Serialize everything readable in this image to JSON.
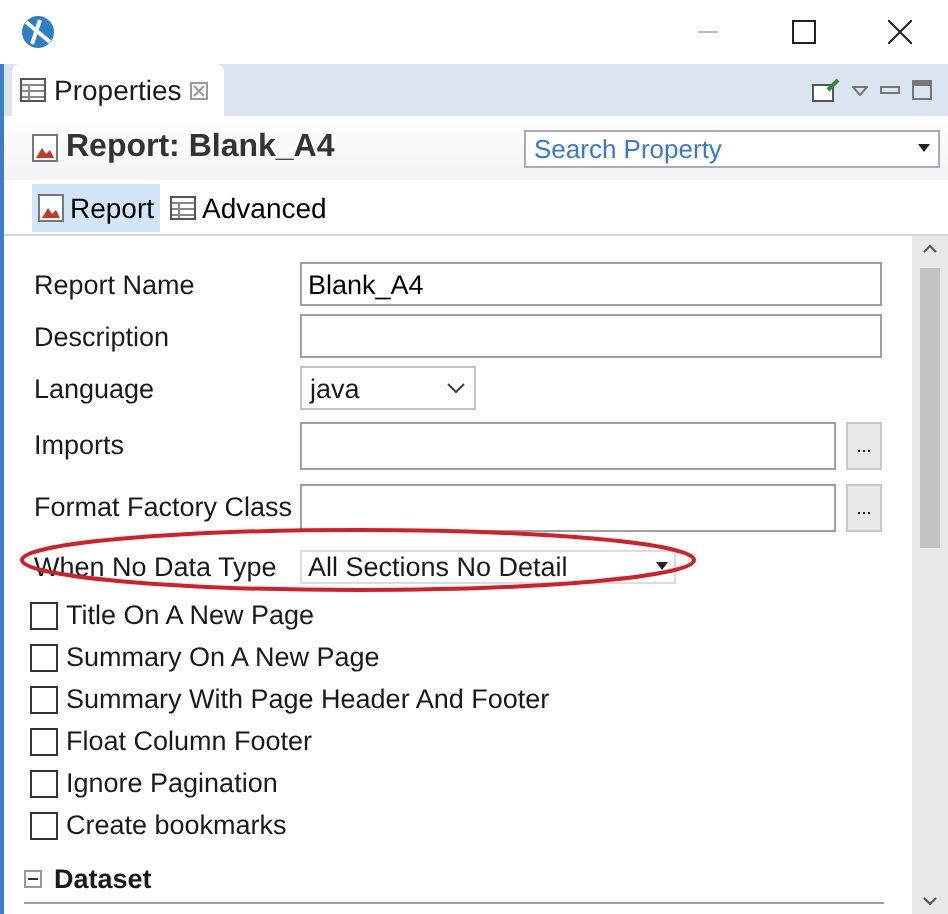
{
  "tab": {
    "label": "Properties"
  },
  "header": {
    "title": "Report: Blank_A4",
    "search": {
      "placeholder": "Search Property"
    }
  },
  "subtabs": [
    {
      "label": "Report",
      "selected": true
    },
    {
      "label": "Advanced",
      "selected": false
    }
  ],
  "fields": [
    {
      "label": "Report Name",
      "kind": "text",
      "value": "Blank_A4",
      "highlighted": false
    },
    {
      "label": "Description",
      "kind": "text",
      "highlighted": false
    },
    {
      "label": "Language",
      "kind": "select",
      "value": "java",
      "highlighted": false
    },
    {
      "label": "Imports",
      "kind": "browse",
      "button": "...",
      "highlighted": false
    },
    {
      "label": "Format Factory Class",
      "kind": "browse",
      "button": "...",
      "highlighted": false
    },
    {
      "label": "When No Data Type",
      "kind": "combo",
      "value": "All Sections No Detail",
      "highlighted": true
    }
  ],
  "checkboxes": [
    {
      "label": "Title On A New Page",
      "checked": false
    },
    {
      "label": "Summary On A New Page",
      "checked": false
    },
    {
      "label": "Summary With Page Header And Footer",
      "checked": false
    },
    {
      "label": "Float Column Footer",
      "checked": false
    },
    {
      "label": "Ignore Pagination",
      "checked": false
    },
    {
      "label": "Create bookmarks",
      "checked": false
    }
  ],
  "section": {
    "title": "Dataset",
    "expanded": true
  }
}
